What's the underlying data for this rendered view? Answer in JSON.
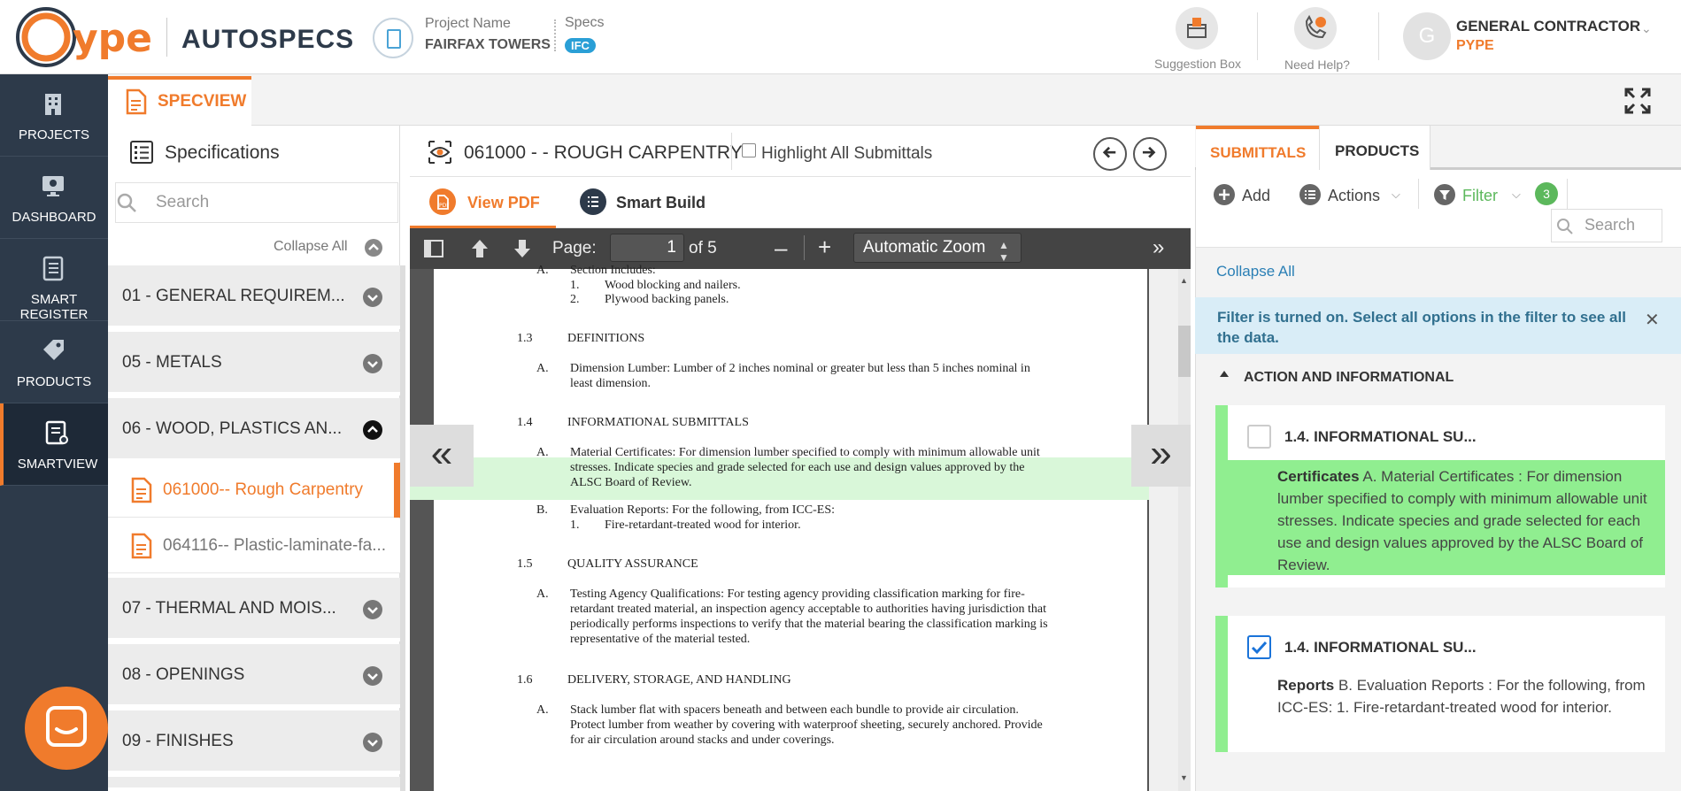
{
  "header": {
    "logo_text": "Pype",
    "product_name": "AUTOSPECS",
    "project_label": "Project Name",
    "project_value": "FAIRFAX TOWERS",
    "specs_label": "Specs",
    "specs_badge": "IFC",
    "suggestion_label": "Suggestion Box",
    "help_label": "Need Help?",
    "avatar_initial": "G",
    "user_name": "GENERAL CONTRACTOR",
    "user_company": "PYPE"
  },
  "sidebar": {
    "items": [
      {
        "label": "PROJECTS",
        "icon": "building-icon"
      },
      {
        "label": "DASHBOARD",
        "icon": "monitor-icon"
      },
      {
        "label": "SMART REGISTER",
        "icon": "register-icon"
      },
      {
        "label": "PRODUCTS",
        "icon": "tag-icon"
      },
      {
        "label": "SMARTVIEW",
        "icon": "smartview-icon"
      }
    ]
  },
  "tabbar": {
    "active_tab": "SPECVIEW"
  },
  "specs": {
    "title": "Specifications",
    "search_placeholder": "Search",
    "collapse_all": "Collapse All",
    "sections": [
      "01 - GENERAL REQUIREM...",
      "05 - METALS",
      "06 - WOOD, PLASTICS AN...",
      "07 - THERMAL AND MOIS...",
      "08 - OPENINGS",
      "09 - FINISHES"
    ],
    "subsections": [
      "061000-- Rough Carpentry",
      "064116-- Plastic-laminate-fa..."
    ]
  },
  "pdf": {
    "title": "061000 - - ROUGH CARPENTRY",
    "highlight_label": "Highlight All Submittals",
    "tab_view_pdf": "View PDF",
    "tab_smart_build": "Smart Build",
    "page_label": "Page:",
    "page_value": "1",
    "page_of": "of 5",
    "zoom": "Automatic Zoom",
    "lines": [
      {
        "n": "A.",
        "t": "Section Includes:"
      },
      {
        "n": "1.",
        "t": "Wood blocking and nailers."
      },
      {
        "n": "2.",
        "t": "Plywood backing panels."
      },
      {
        "n": "1.3",
        "t": "DEFINITIONS"
      },
      {
        "n": "A.",
        "t": "Dimension Lumber:  Lumber of 2 inches nominal or greater but less than 5 inches nominal in"
      },
      {
        "n": "",
        "t": "least dimension."
      },
      {
        "n": "1.4",
        "t": "INFORMATIONAL SUBMITTALS"
      },
      {
        "n": "A.",
        "t": "Material Certificates:  For dimension lumber specified to comply with minimum allowable unit"
      },
      {
        "n": "",
        "t": "stresses.  Indicate species and grade selected for each use and design values approved by the"
      },
      {
        "n": "",
        "t": "ALSC Board of Review."
      },
      {
        "n": "B.",
        "t": "Evaluation Reports:  For the following, from ICC-ES:"
      },
      {
        "n": "1.",
        "t": "Fire-retardant-treated wood for interior."
      },
      {
        "n": "1.5",
        "t": "QUALITY ASSURANCE"
      },
      {
        "n": "A.",
        "t": "Testing Agency Qualifications:  For testing agency providing classification marking for fire-"
      },
      {
        "n": "",
        "t": "retardant treated material, an inspection agency acceptable to authorities having jurisdiction that"
      },
      {
        "n": "",
        "t": "periodically performs inspections to verify that the material bearing the classification marking is"
      },
      {
        "n": "",
        "t": "representative of the material tested."
      },
      {
        "n": "1.6",
        "t": "DELIVERY, STORAGE, AND HANDLING"
      },
      {
        "n": "A.",
        "t": "Stack lumber flat with spacers beneath and between each bundle to provide air circulation."
      },
      {
        "n": "",
        "t": "Protect lumber from weather by covering with waterproof sheeting, securely anchored.  Provide"
      },
      {
        "n": "",
        "t": "for air circulation around stacks and under coverings."
      }
    ]
  },
  "right": {
    "tab_submittals": "SUBMITTALS",
    "tab_products": "PRODUCTS",
    "add_label": "Add",
    "actions_label": "Actions",
    "filter_label": "Filter",
    "filter_count": "3",
    "search_placeholder": "Search",
    "collapse_all": "Collapse All",
    "filter_alert": "Filter is turned on. Select all options in the filter to see all the data.",
    "group_label": "ACTION AND INFORMATIONAL",
    "cards": [
      {
        "title": "1.4. INFORMATIONAL SU...",
        "type": "Certificates",
        "text": " A. Material Certificates : For dimension lumber specified to comply with minimum allowable unit stresses. Indicate species and grade selected for each use and design values approved by the ALSC Board of Review.",
        "checked": false
      },
      {
        "title": "1.4. INFORMATIONAL SU...",
        "type": "Reports",
        "text": " B. Evaluation Reports : For the following, from ICC-ES: 1. Fire-retardant-treated wood for interior.",
        "checked": true
      }
    ]
  },
  "colors": {
    "accent": "#f07b2c",
    "sidebar": "#2d3a4a",
    "highlight": "#90ee90",
    "info": "#d9edf7"
  }
}
